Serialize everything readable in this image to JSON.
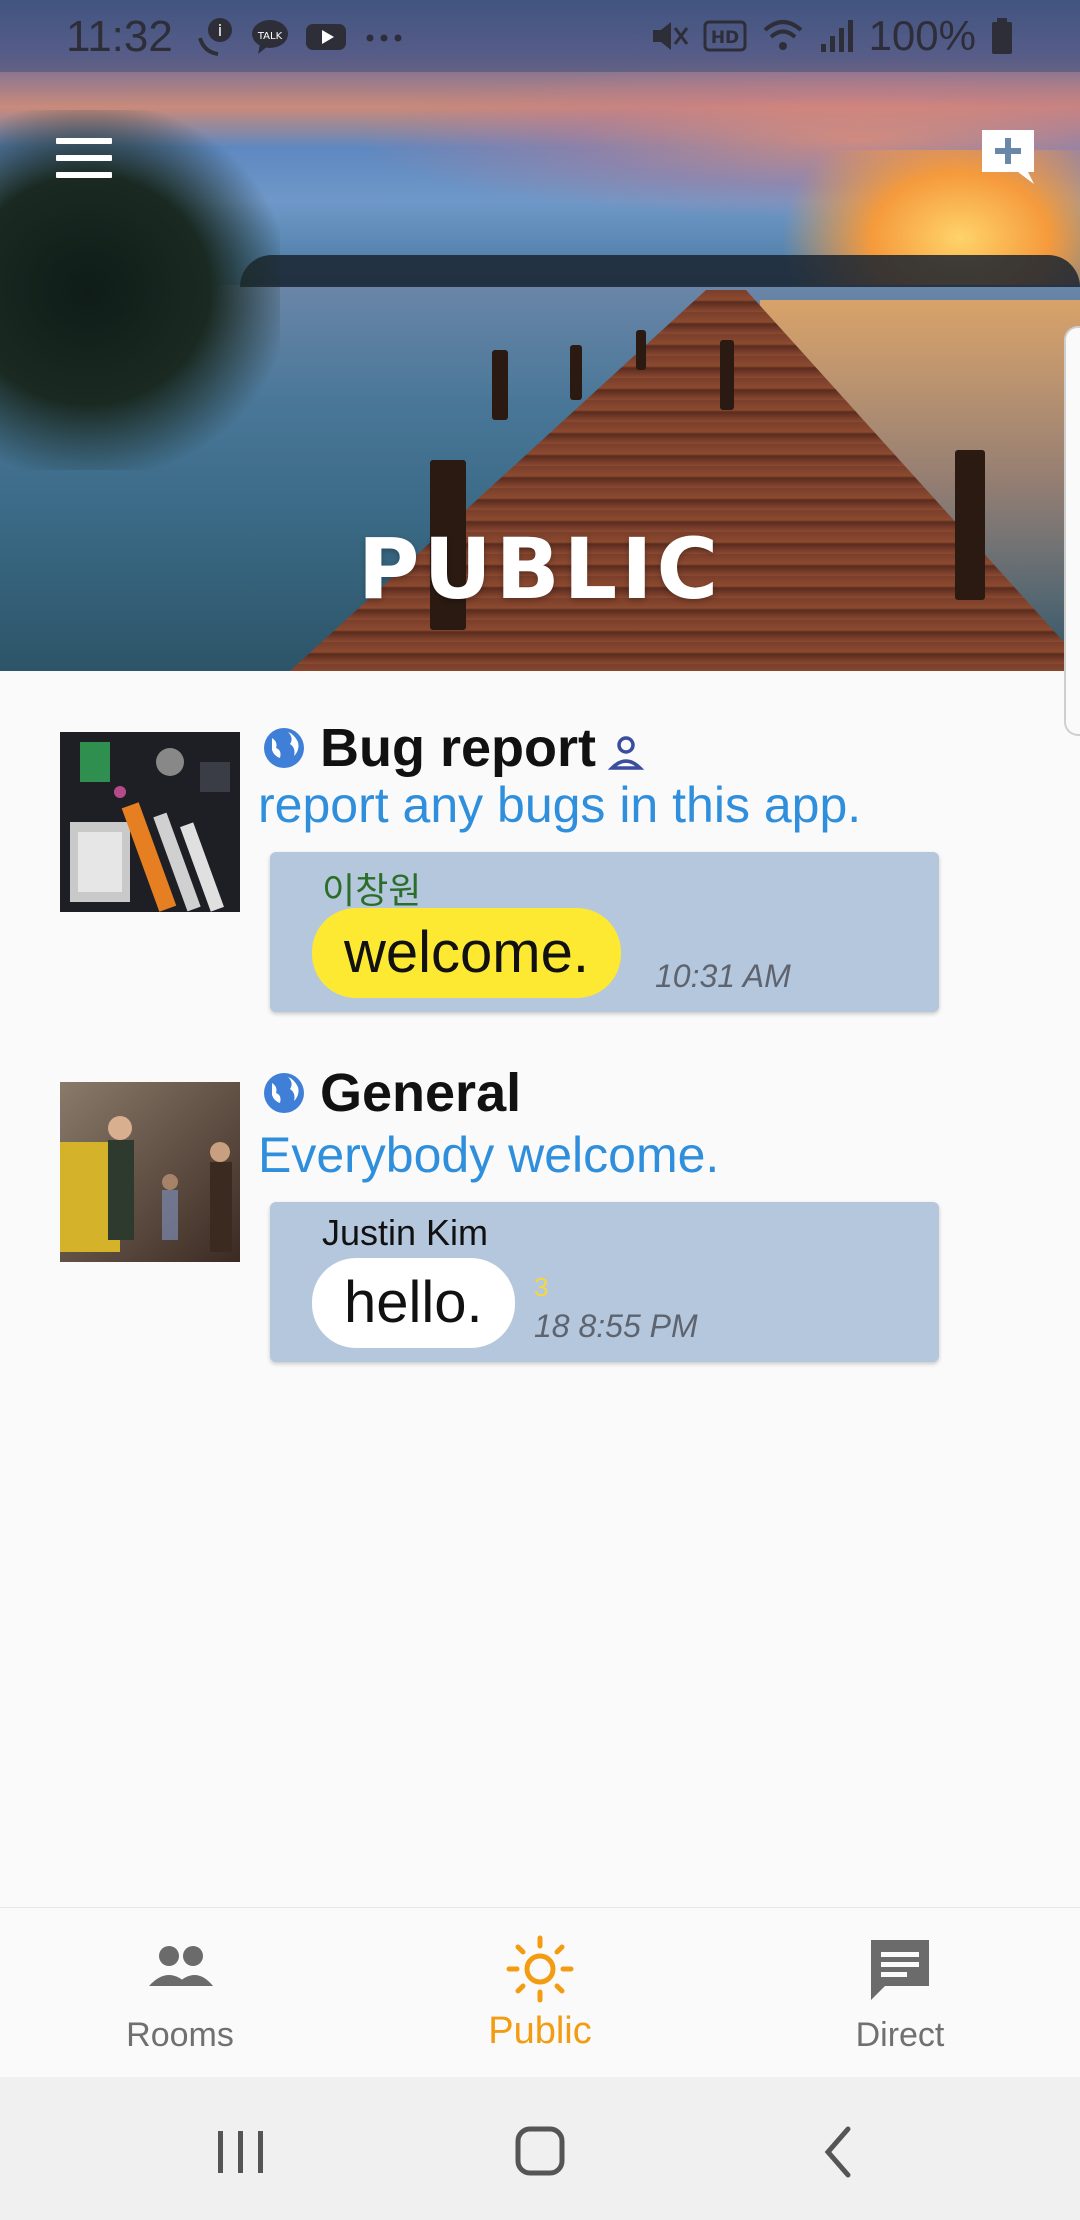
{
  "status_bar": {
    "time": "11:32",
    "battery_pct": "100%",
    "left_icons": [
      "phone-info-icon",
      "kakaotalk-icon",
      "youtube-icon",
      "more-dots-icon"
    ],
    "right_icons": [
      "mute-icon",
      "hd-icon",
      "wifi-icon",
      "signal-icon",
      "battery-icon"
    ]
  },
  "header": {
    "title": "PUBLIC",
    "menu_icon": "hamburger-menu-icon",
    "add_icon": "add-chat-icon"
  },
  "rooms": [
    {
      "name": "Bug report",
      "description": "report any bugs in this app.",
      "thumb": "circuit-board-photo",
      "last_message": {
        "sender": "이창원",
        "text": "welcome.",
        "time": "10:31 AM",
        "bubble_color": "#fde932",
        "sender_color": "#2a6e2a"
      }
    },
    {
      "name": "General",
      "description": "Everybody welcome.",
      "thumb": "figurines-photo",
      "last_message": {
        "sender": "Justin Kim",
        "text": "hello.",
        "unread": "3",
        "time": "18 8:55 PM",
        "bubble_color": "#ffffff",
        "sender_color": "#111111"
      }
    }
  ],
  "bottom_nav": {
    "items": [
      {
        "label": "Rooms",
        "icon": "people-icon",
        "active": false
      },
      {
        "label": "Public",
        "icon": "sun-icon",
        "active": true
      },
      {
        "label": "Direct",
        "icon": "message-icon",
        "active": false
      }
    ]
  },
  "colors": {
    "accent": "#f39c12",
    "link_blue": "#2f8fdc",
    "card_bg": "#b5c7dc"
  }
}
